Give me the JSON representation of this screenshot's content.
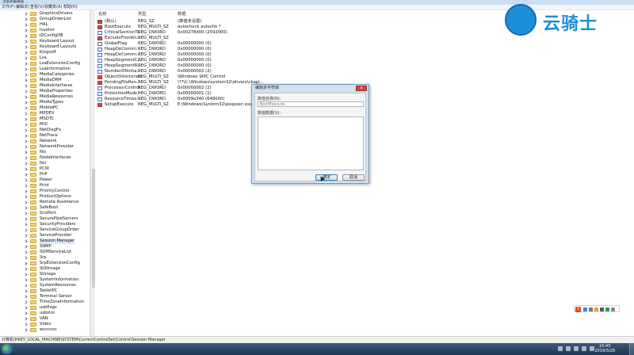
{
  "window": {
    "title": "注册表编辑器"
  },
  "menu": [
    "文件(F)",
    "编辑(E)",
    "查看(V)",
    "收藏夹(A)",
    "帮助(H)"
  ],
  "tree": {
    "items": [
      "GraphicsDrivers",
      "GroupOrderList",
      "HAL",
      "hivelist",
      "IDConfigDB",
      "Keyboard Layout",
      "Keyboard Layouts",
      "Kingsoft",
      "Lsa",
      "LsaExtensionConfig",
      "LsaInformation",
      "MediaCategories",
      "MediaDRM",
      "MediaInterfaces",
      "MediaProperties",
      "MediaResources",
      "MediaTypes",
      "MobilePC",
      "MPDEV",
      "MSDTC",
      "MUI",
      "NetDiagFx",
      "NetTrace",
      "Network",
      "NetworkProvider",
      "Nls",
      "NodeInterfaces",
      "Nsi",
      "PCW",
      "PnP",
      "Power",
      "Print",
      "PriorityControl",
      "ProductOptions",
      "Remote Assistance",
      "SafeBoot",
      "ScsiPort",
      "SecurePipeServers",
      "SecurityProviders",
      "ServiceGroupOrder",
      "ServiceProvider",
      "Session Manager",
      "SNMP",
      "SQMServiceList",
      "Srp",
      "SrpExtensionConfig",
      "StillImage",
      "Storage",
      "SystemInformation",
      "SystemResources",
      "TabletPC",
      "Terminal Server",
      "TimeZoneInformation",
      "usbflags",
      "usbstor",
      "VAN",
      "Video",
      "wcncsvc"
    ],
    "selected": "Session Manager"
  },
  "columns": {
    "name": "名称",
    "type": "类型",
    "data": "数据"
  },
  "values": [
    {
      "name": "(默认)",
      "type": "REG_SZ",
      "data": "(数值未设置)",
      "icon": "string-value-icon"
    },
    {
      "name": "BootExecute",
      "type": "REG_MULTI_SZ",
      "data": "autocheck autochk *",
      "icon": "string-value-icon"
    },
    {
      "name": "CriticalSectionTi...",
      "type": "REG_DWORD",
      "data": "0x00278d00 (2592000)",
      "icon": "binary-value-icon"
    },
    {
      "name": "ExcludeFromKn...",
      "type": "REG_MULTI_SZ",
      "data": "",
      "icon": "string-value-icon"
    },
    {
      "name": "GlobalFlag",
      "type": "REG_DWORD",
      "data": "0x00000000 (0)",
      "icon": "binary-value-icon"
    },
    {
      "name": "HeapDeCommi...",
      "type": "REG_DWORD",
      "data": "0x00000000 (0)",
      "icon": "binary-value-icon"
    },
    {
      "name": "HeapDeCommi...",
      "type": "REG_DWORD",
      "data": "0x00000000 (0)",
      "icon": "binary-value-icon"
    },
    {
      "name": "HeapSegmentC...",
      "type": "REG_DWORD",
      "data": "0x00000000 (0)",
      "icon": "binary-value-icon"
    },
    {
      "name": "HeapSegmentR...",
      "type": "REG_DWORD",
      "data": "0x00000000 (0)",
      "icon": "binary-value-icon"
    },
    {
      "name": "NumberOfInitia...",
      "type": "REG_DWORD",
      "data": "0x00000002 (2)",
      "icon": "binary-value-icon"
    },
    {
      "name": "ObjectDirectories",
      "type": "REG_MULTI_SZ",
      "data": "\\Windows \\RPC Control",
      "icon": "string-value-icon"
    },
    {
      "name": "PendingFileRen...",
      "type": "REG_MULTI_SZ",
      "data": "\\??\\C:\\Windows\\system32\\drivers\\ckapi...",
      "icon": "string-value-icon"
    },
    {
      "name": "ProcessorControl",
      "type": "REG_DWORD",
      "data": "0x00000002 (2)",
      "icon": "binary-value-icon"
    },
    {
      "name": "ProtectionMode",
      "type": "REG_DWORD",
      "data": "0x00000001 (1)",
      "icon": "binary-value-icon"
    },
    {
      "name": "ResourceTimeo...",
      "type": "REG_DWORD",
      "data": "0x0009e340 (648000)",
      "icon": "binary-value-icon"
    },
    {
      "name": "SetupExecute",
      "type": "REG_MULTI_SZ",
      "data": "E:\\Windows\\System32\\poqexec.exe /display...",
      "icon": "string-value-icon"
    }
  ],
  "dialog": {
    "title": "编辑多字符串",
    "close": "x",
    "name_label": "数值名称(N):",
    "name_value": "BootExecute",
    "data_label": "数值数据(V):",
    "data_value": "",
    "ok": "确定",
    "cancel": "取消"
  },
  "status": {
    "path": "计算机\\HKEY_LOCAL_MACHINE\\SYSTEM\\CurrentControlSet\\Control\\Session Manager"
  },
  "ime": {
    "logo": "S"
  },
  "clock": {
    "time": "15:43",
    "date": "2019/3/28"
  },
  "watermark": {
    "text": "云骑士"
  }
}
